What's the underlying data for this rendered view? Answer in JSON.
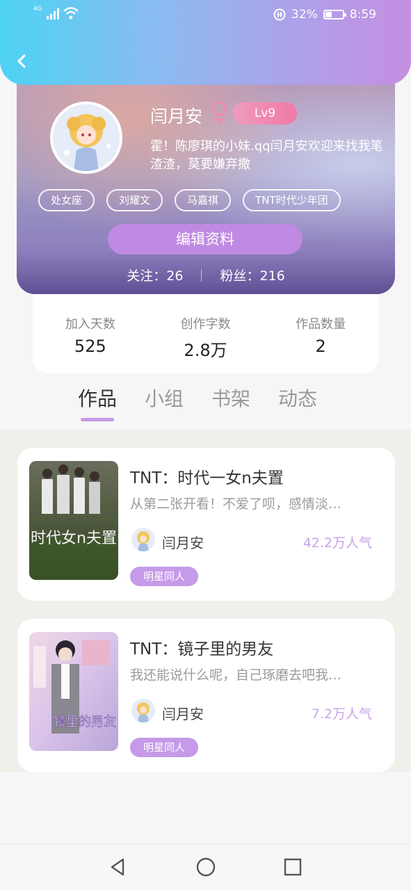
{
  "status_bar": {
    "network": "4G",
    "battery": "32%",
    "time": "8:59"
  },
  "profile": {
    "name": "闫月安",
    "level": "Lv9",
    "bio": "霍！陈廖琪的小妹.qq闫月安欢迎来找我笔渣渣，莫要嫌弃撒",
    "tags": [
      "处女座",
      "刘耀文",
      "马嘉祺",
      "TNT时代少年团"
    ],
    "edit_label": "编辑资料",
    "following_label": "关注：26",
    "fans_label": "粉丝：216"
  },
  "stats": [
    {
      "label": "加入天数",
      "value": "525"
    },
    {
      "label": "创作字数",
      "value": "2.8万"
    },
    {
      "label": "作品数量",
      "value": "2"
    }
  ],
  "tabs": [
    "作品",
    "小组",
    "书架",
    "动态"
  ],
  "works": [
    {
      "title": "TNT：时代一女n夫置",
      "description": "从第二张开看！不爱了呗，感情淡…",
      "author": "闫月安",
      "popularity": "42.2万人气",
      "category": "明星同人",
      "cover_text": "时代女n夫置"
    },
    {
      "title": "TNT：镜子里的男友",
      "description": "我还能说什么呢，自己琢磨去吧我…",
      "author": "闫月安",
      "popularity": "7.2万人气",
      "category": "明星同人",
      "cover_text": "镜里的男友"
    }
  ],
  "colors": {
    "accent": "#c59ae8",
    "header_start": "#4cd3f4",
    "header_end": "#c58fe2"
  },
  "icons": [
    "back-icon",
    "female-icon",
    "wifi-icon",
    "signal-icon",
    "battery-icon",
    "nav-back-icon",
    "nav-home-icon",
    "nav-recent-icon"
  ]
}
